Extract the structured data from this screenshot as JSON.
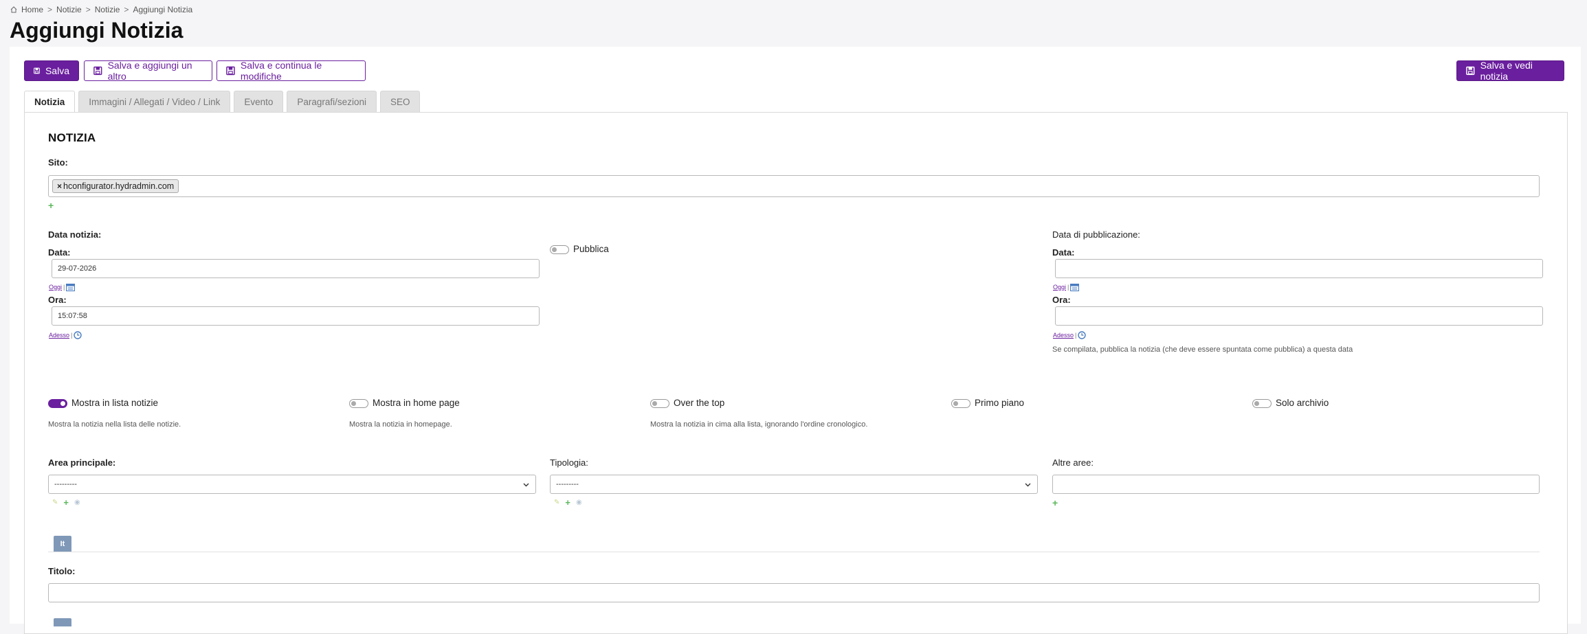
{
  "breadcrumb": [
    "Home",
    "Notizie",
    "Notizie",
    "Aggiungi Notizia"
  ],
  "page_title": "Aggiungi Notizia",
  "toolbar": {
    "save": "Salva",
    "save_add": "Salva e aggiungi un altro",
    "save_continue": "Salva e continua le modifiche",
    "save_view": "Salva e vedi notizia"
  },
  "tabs": [
    "Notizia",
    "Immagini / Allegati / Video / Link",
    "Evento",
    "Paragrafi/sezioni",
    "SEO"
  ],
  "form": {
    "section_title": "NOTIZIA",
    "sito_label": "Sito:",
    "sito_tag": "hconfigurator.hydradmin.com",
    "data_notizia_label": "Data notizia:",
    "data_label": "Data:",
    "data_value": "29-07-2026",
    "oggi": "Oggi",
    "ora_label": "Ora:",
    "ora_value": "15:07:58",
    "adesso": "Adesso",
    "pubblica_label": "Pubblica",
    "data_pubblicazione_label": "Data di pubblicazione:",
    "pub_data_label": "Data:",
    "pub_data_value": "",
    "pub_oggi": "Oggi",
    "pub_ora_label": "Ora:",
    "pub_ora_value": "",
    "pub_adesso": "Adesso",
    "pub_help": "Se compilata, pubblica la notizia (che deve essere spuntata come pubblica) a questa data",
    "toggles": [
      {
        "label": "Mostra in lista notizie",
        "on": true,
        "help": "Mostra la notizia nella lista delle notizie."
      },
      {
        "label": "Mostra in home page",
        "on": false,
        "help": "Mostra la notizia in homepage."
      },
      {
        "label": "Over the top",
        "on": false,
        "help": "Mostra la notizia in cima alla lista, ignorando l'ordine cronologico."
      },
      {
        "label": "Primo piano",
        "on": false,
        "help": ""
      },
      {
        "label": "Solo archivio",
        "on": false,
        "help": ""
      }
    ],
    "area_principale_label": "Area principale:",
    "area_principale_value": "---------",
    "tipologia_label": "Tipologia:",
    "tipologia_value": "---------",
    "altre_aree_label": "Altre aree:",
    "lang_tab": "It",
    "titolo_label": "Titolo:"
  },
  "colors": {
    "accent": "#6a1f9e",
    "add_green": "#5cb85c",
    "lang_tab": "#7f98b8"
  }
}
